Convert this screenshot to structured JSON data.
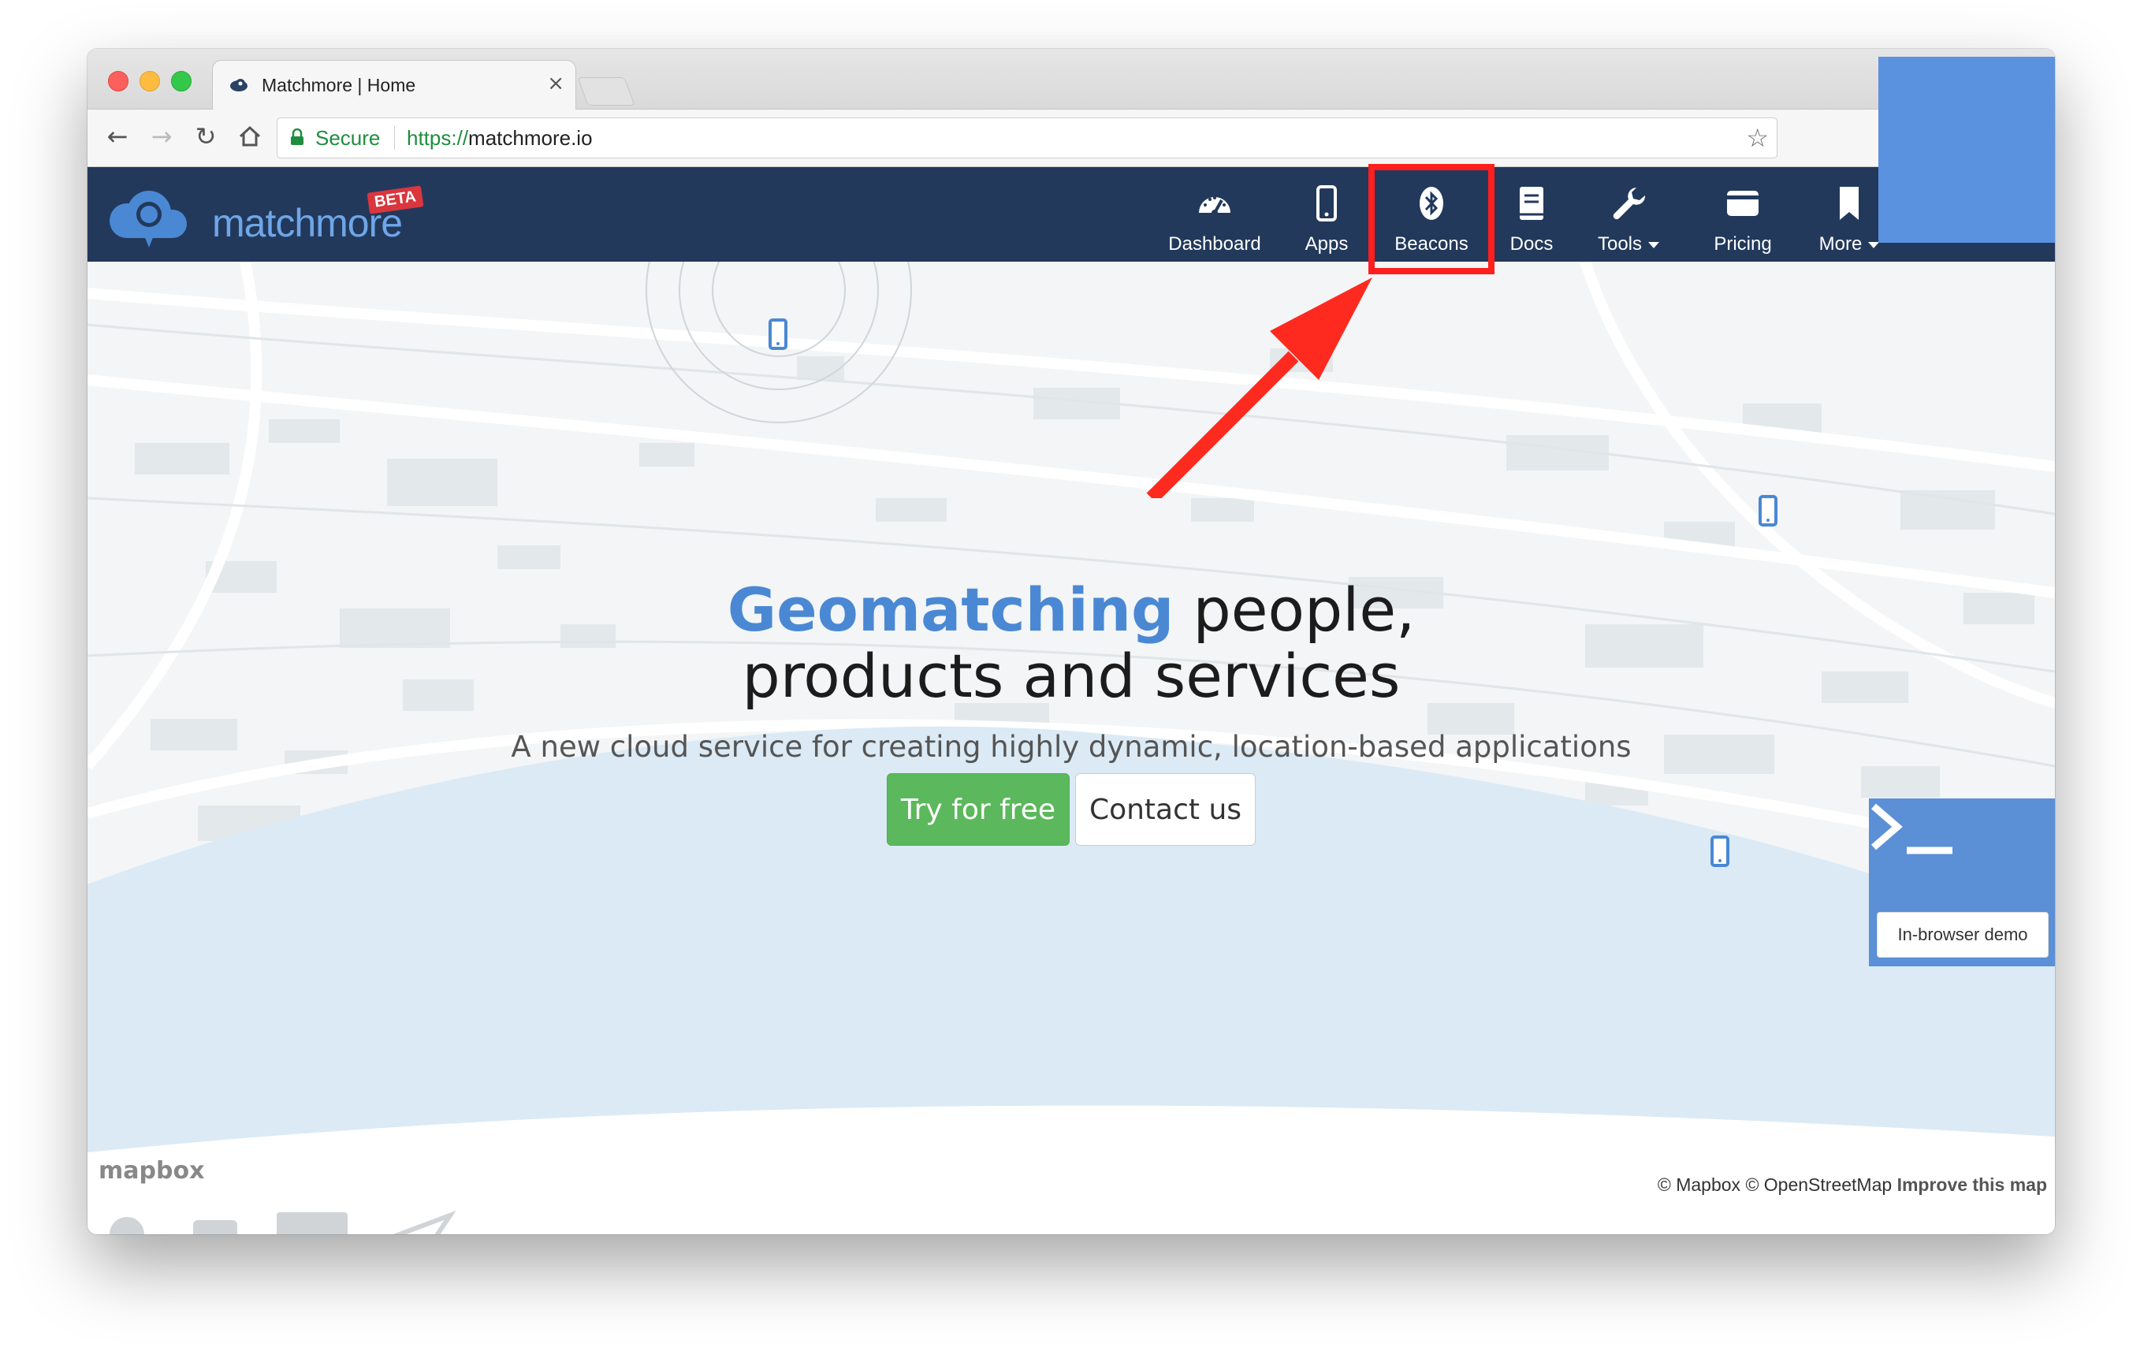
{
  "browser": {
    "tab_title": "Matchmore | Home",
    "tab_close": "×",
    "security_label": "Secure",
    "url_scheme": "https://",
    "url_host": "matchmore.io"
  },
  "site": {
    "brand": "matchmore",
    "badge": "BETA",
    "nav": {
      "dashboard": "Dashboard",
      "apps": "Apps",
      "beacons": "Beacons",
      "docs": "Docs",
      "tools": "Tools",
      "pricing": "Pricing",
      "more": "More"
    }
  },
  "hero": {
    "title_accent": "Geomatching",
    "title_rest": " people,",
    "title_line2": "products and services",
    "subtitle": "A new cloud service for creating highly dynamic, location-based applications",
    "primary_button": "Try for free",
    "secondary_button": "Contact us"
  },
  "demo": {
    "label": "In-browser demo"
  },
  "map": {
    "logo": "mapbox",
    "attribution_mapbox": "© Mapbox",
    "attribution_osm": "© OpenStreetMap",
    "improve": "Improve this map"
  },
  "colors": {
    "nav_bg": "#22395b",
    "accent": "#4a88d4",
    "primary_button": "#5cb85c",
    "highlight": "#ff1f1f",
    "overlay": "#5b92e0",
    "water": "#dbeaf5"
  },
  "icons": [
    "dashboard-icon",
    "phone-icon",
    "bluetooth-icon",
    "book-icon",
    "wrench-icon",
    "wallet-icon",
    "bookmark-icon",
    "terminal-icon",
    "arrow-annotation"
  ]
}
